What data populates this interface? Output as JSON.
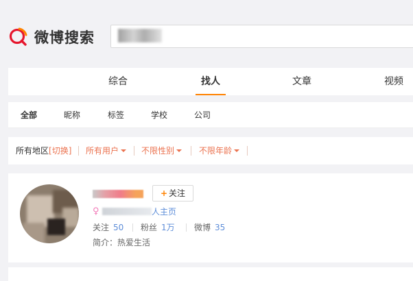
{
  "brand": {
    "name": "微博搜索"
  },
  "search": {
    "query": ""
  },
  "tabs": [
    {
      "label": "综合",
      "active": false
    },
    {
      "label": "找人",
      "active": true
    },
    {
      "label": "文章",
      "active": false
    },
    {
      "label": "视频",
      "active": false
    }
  ],
  "category_filters": [
    {
      "label": "全部",
      "active": true
    },
    {
      "label": "昵称",
      "active": false
    },
    {
      "label": "标签",
      "active": false
    },
    {
      "label": "学校",
      "active": false
    },
    {
      "label": "公司",
      "active": false
    }
  ],
  "region_filter": {
    "label": "所有地区",
    "switch": "[切换]"
  },
  "dropdown_filters": [
    {
      "label": "所有用户"
    },
    {
      "label": "不限性别"
    },
    {
      "label": "不限年龄"
    }
  ],
  "result": {
    "follow_label": "关注",
    "follow_plus": "+",
    "gender_symbol": "♀",
    "homepage_suffix": "人主页",
    "stats": [
      {
        "label": "关注",
        "value": "50"
      },
      {
        "label": "粉丝",
        "value": "1万"
      },
      {
        "label": "微博",
        "value": "35"
      }
    ],
    "bio": "简介：热爱生活"
  },
  "colors": {
    "accent": "#ff8200",
    "filter_link": "#eb7350",
    "link": "#5d8dd8",
    "logo_red": "#e6162d"
  }
}
